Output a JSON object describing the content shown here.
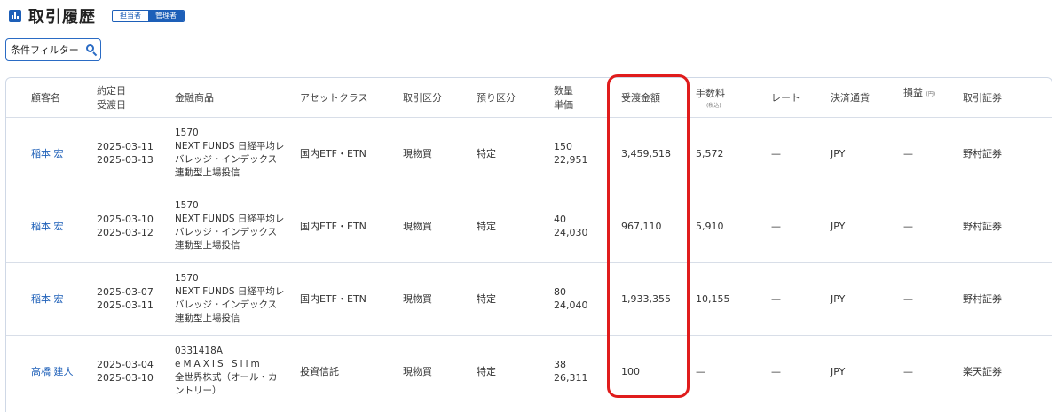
{
  "header": {
    "title": "取引履歴",
    "roles": [
      "担当者",
      "管理者"
    ],
    "active_role": "管理者"
  },
  "filter": {
    "label": "条件フィルター"
  },
  "table": {
    "columns": {
      "customer": "顧客名",
      "date_contract": "約定日",
      "date_delivery": "受渡日",
      "product": "金融商品",
      "asset_class": "アセットクラス",
      "trade_type": "取引区分",
      "custody": "預り区分",
      "qty": "数量",
      "unit_price": "単価",
      "amount": "受渡金額",
      "fee": "手数料",
      "fee_note": "(税込)",
      "rate": "レート",
      "currency": "決済通貨",
      "pnl": "損益",
      "pnl_unit": "(円)",
      "broker": "取引証券"
    },
    "rows": [
      {
        "customer": "稲本 宏",
        "date_contract": "2025-03-11",
        "date_delivery": "2025-03-13",
        "product": [
          "1570",
          "NEXT FUNDS 日経平均レ",
          "バレッジ・インデックス",
          "連動型上場投信"
        ],
        "asset_class": "国内ETF・ETN",
        "trade_type": "現物買",
        "custody": "特定",
        "qty": "150",
        "unit_price": "22,951",
        "amount": "3,459,518",
        "fee": "5,572",
        "rate": "—",
        "currency": "JPY",
        "pnl": "—",
        "broker": "野村証券"
      },
      {
        "customer": "稲本 宏",
        "date_contract": "2025-03-10",
        "date_delivery": "2025-03-12",
        "product": [
          "1570",
          "NEXT FUNDS 日経平均レ",
          "バレッジ・インデックス",
          "連動型上場投信"
        ],
        "asset_class": "国内ETF・ETN",
        "trade_type": "現物買",
        "custody": "特定",
        "qty": "40",
        "unit_price": "24,030",
        "amount": "967,110",
        "fee": "5,910",
        "rate": "—",
        "currency": "JPY",
        "pnl": "—",
        "broker": "野村証券"
      },
      {
        "customer": "稲本 宏",
        "date_contract": "2025-03-07",
        "date_delivery": "2025-03-11",
        "product": [
          "1570",
          "NEXT FUNDS 日経平均レ",
          "バレッジ・インデックス",
          "連動型上場投信"
        ],
        "asset_class": "国内ETF・ETN",
        "trade_type": "現物買",
        "custody": "特定",
        "qty": "80",
        "unit_price": "24,040",
        "amount": "1,933,355",
        "fee": "10,155",
        "rate": "—",
        "currency": "JPY",
        "pnl": "—",
        "broker": "野村証券"
      },
      {
        "customer": "高橋 建人",
        "date_contract": "2025-03-04",
        "date_delivery": "2025-03-10",
        "product": [
          "0331418A",
          "eMAXIS Slim",
          "全世界株式（オール・カ",
          "ントリー）"
        ],
        "asset_class": "投資信託",
        "trade_type": "現物買",
        "custody": "特定",
        "qty": "38",
        "unit_price": "26,311",
        "amount": "100",
        "fee": "—",
        "rate": "—",
        "currency": "JPY",
        "pnl": "—",
        "broker": "楽天証券"
      }
    ]
  },
  "colors": {
    "accent": "#1d5fb8",
    "highlight": "#e01c1c"
  }
}
